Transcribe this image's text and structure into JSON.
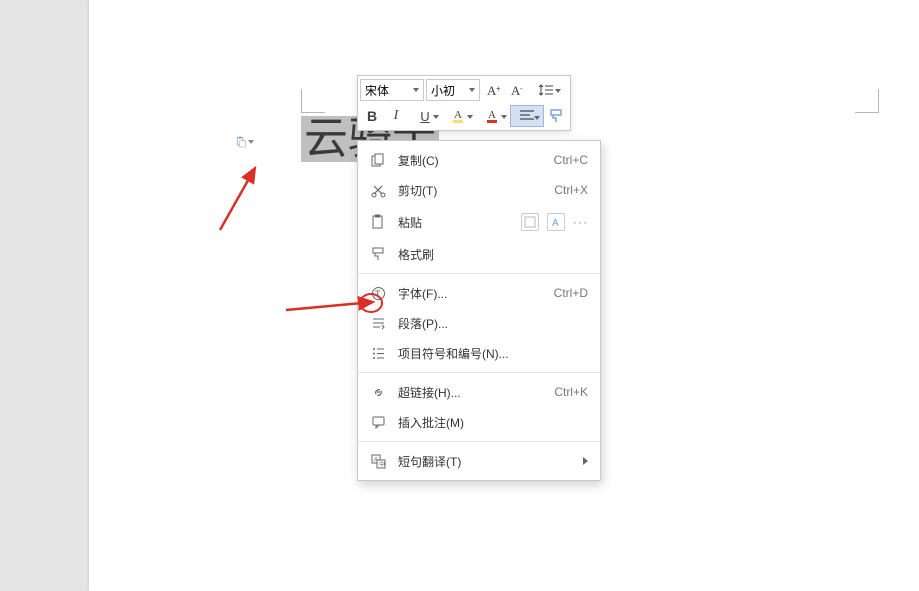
{
  "document": {
    "selected_text": "云骑士"
  },
  "toolbar": {
    "font_family": "宋体",
    "font_size": "小初",
    "bold": "B",
    "italic": "I",
    "underline": "U",
    "increase_font": "A",
    "decrease_font": "A",
    "highlight": "A",
    "font_color": "A"
  },
  "menu": {
    "copy": {
      "label": "复制(C)",
      "shortcut": "Ctrl+C"
    },
    "cut": {
      "label": "剪切(T)",
      "shortcut": "Ctrl+X"
    },
    "paste": {
      "label": "粘贴"
    },
    "format_painter": {
      "label": "格式刷"
    },
    "font": {
      "label": "字体(F)...",
      "shortcut": "Ctrl+D"
    },
    "paragraph": {
      "label": "段落(P)..."
    },
    "bullets": {
      "label": "项目符号和编号(N)..."
    },
    "hyperlink": {
      "label": "超链接(H)...",
      "shortcut": "Ctrl+K"
    },
    "comment": {
      "label": "插入批注(M)"
    },
    "translate": {
      "label": "短句翻译(T)"
    }
  }
}
